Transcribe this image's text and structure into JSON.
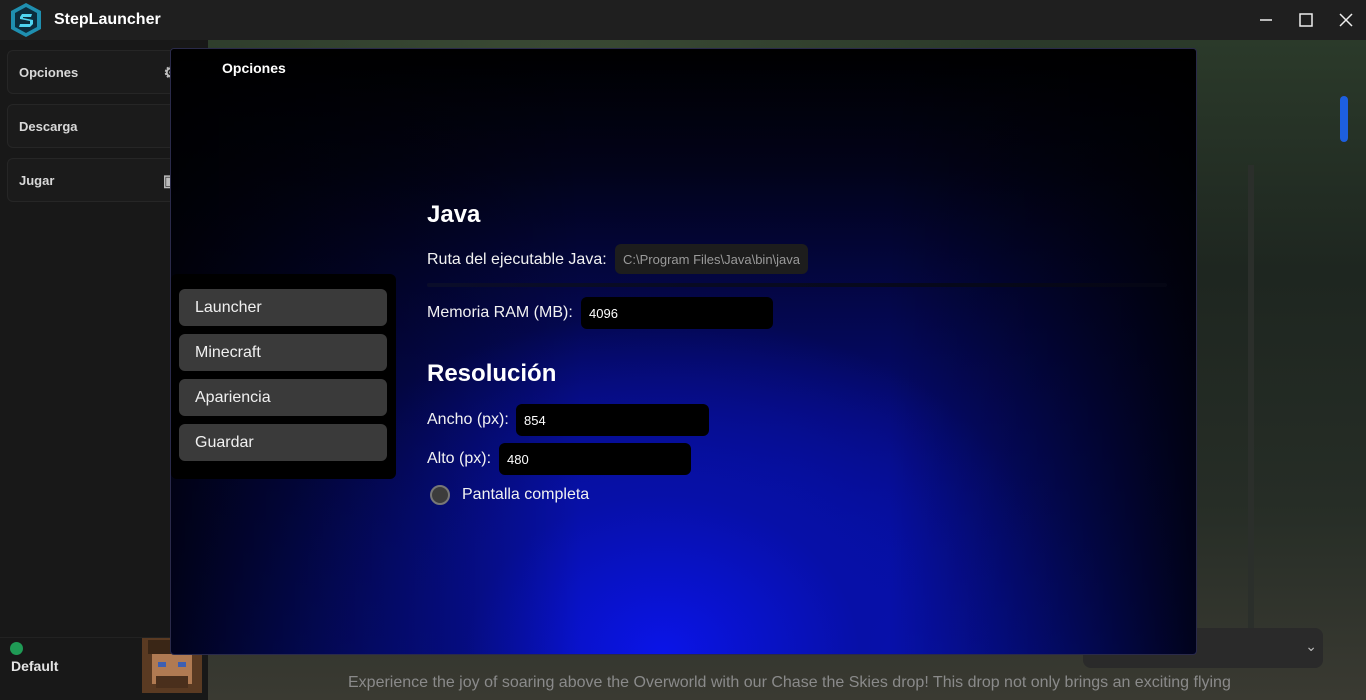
{
  "window": {
    "title": "StepLauncher",
    "controls": {
      "minimize": "—",
      "maximize": "☐",
      "close": "✕"
    }
  },
  "sidebar": {
    "items": [
      {
        "label": "Opciones",
        "icon": "gear-icon"
      },
      {
        "label": "Descarga",
        "icon": "download-icon"
      },
      {
        "label": "Jugar",
        "icon": "gamepad-icon"
      }
    ],
    "profile": {
      "name": "Default",
      "status": "online"
    }
  },
  "background": {
    "text": "Experience the joy of soaring above the Overworld with our Chase the Skies drop! This drop not only brings an exciting flying"
  },
  "modal": {
    "title": "Opciones",
    "nav": [
      "Launcher",
      "Minecraft",
      "Apariencia",
      "Guardar"
    ],
    "java": {
      "title": "Java",
      "path_label": "Ruta del ejecutable Java:",
      "path_value": "C:\\Program Files\\Java\\bin\\java",
      "ram_label": "Memoria RAM (MB):",
      "ram_value": "4096"
    },
    "resolution": {
      "title": "Resolución",
      "width_label": "Ancho (px):",
      "width_value": "854",
      "height_label": "Alto (px):",
      "height_value": "480",
      "fullscreen_label": "Pantalla completa",
      "fullscreen_checked": false
    }
  },
  "colors": {
    "accent": "#1d5fe0",
    "modal_glow": "#0a14e8",
    "status_online": "#1f9a55"
  }
}
